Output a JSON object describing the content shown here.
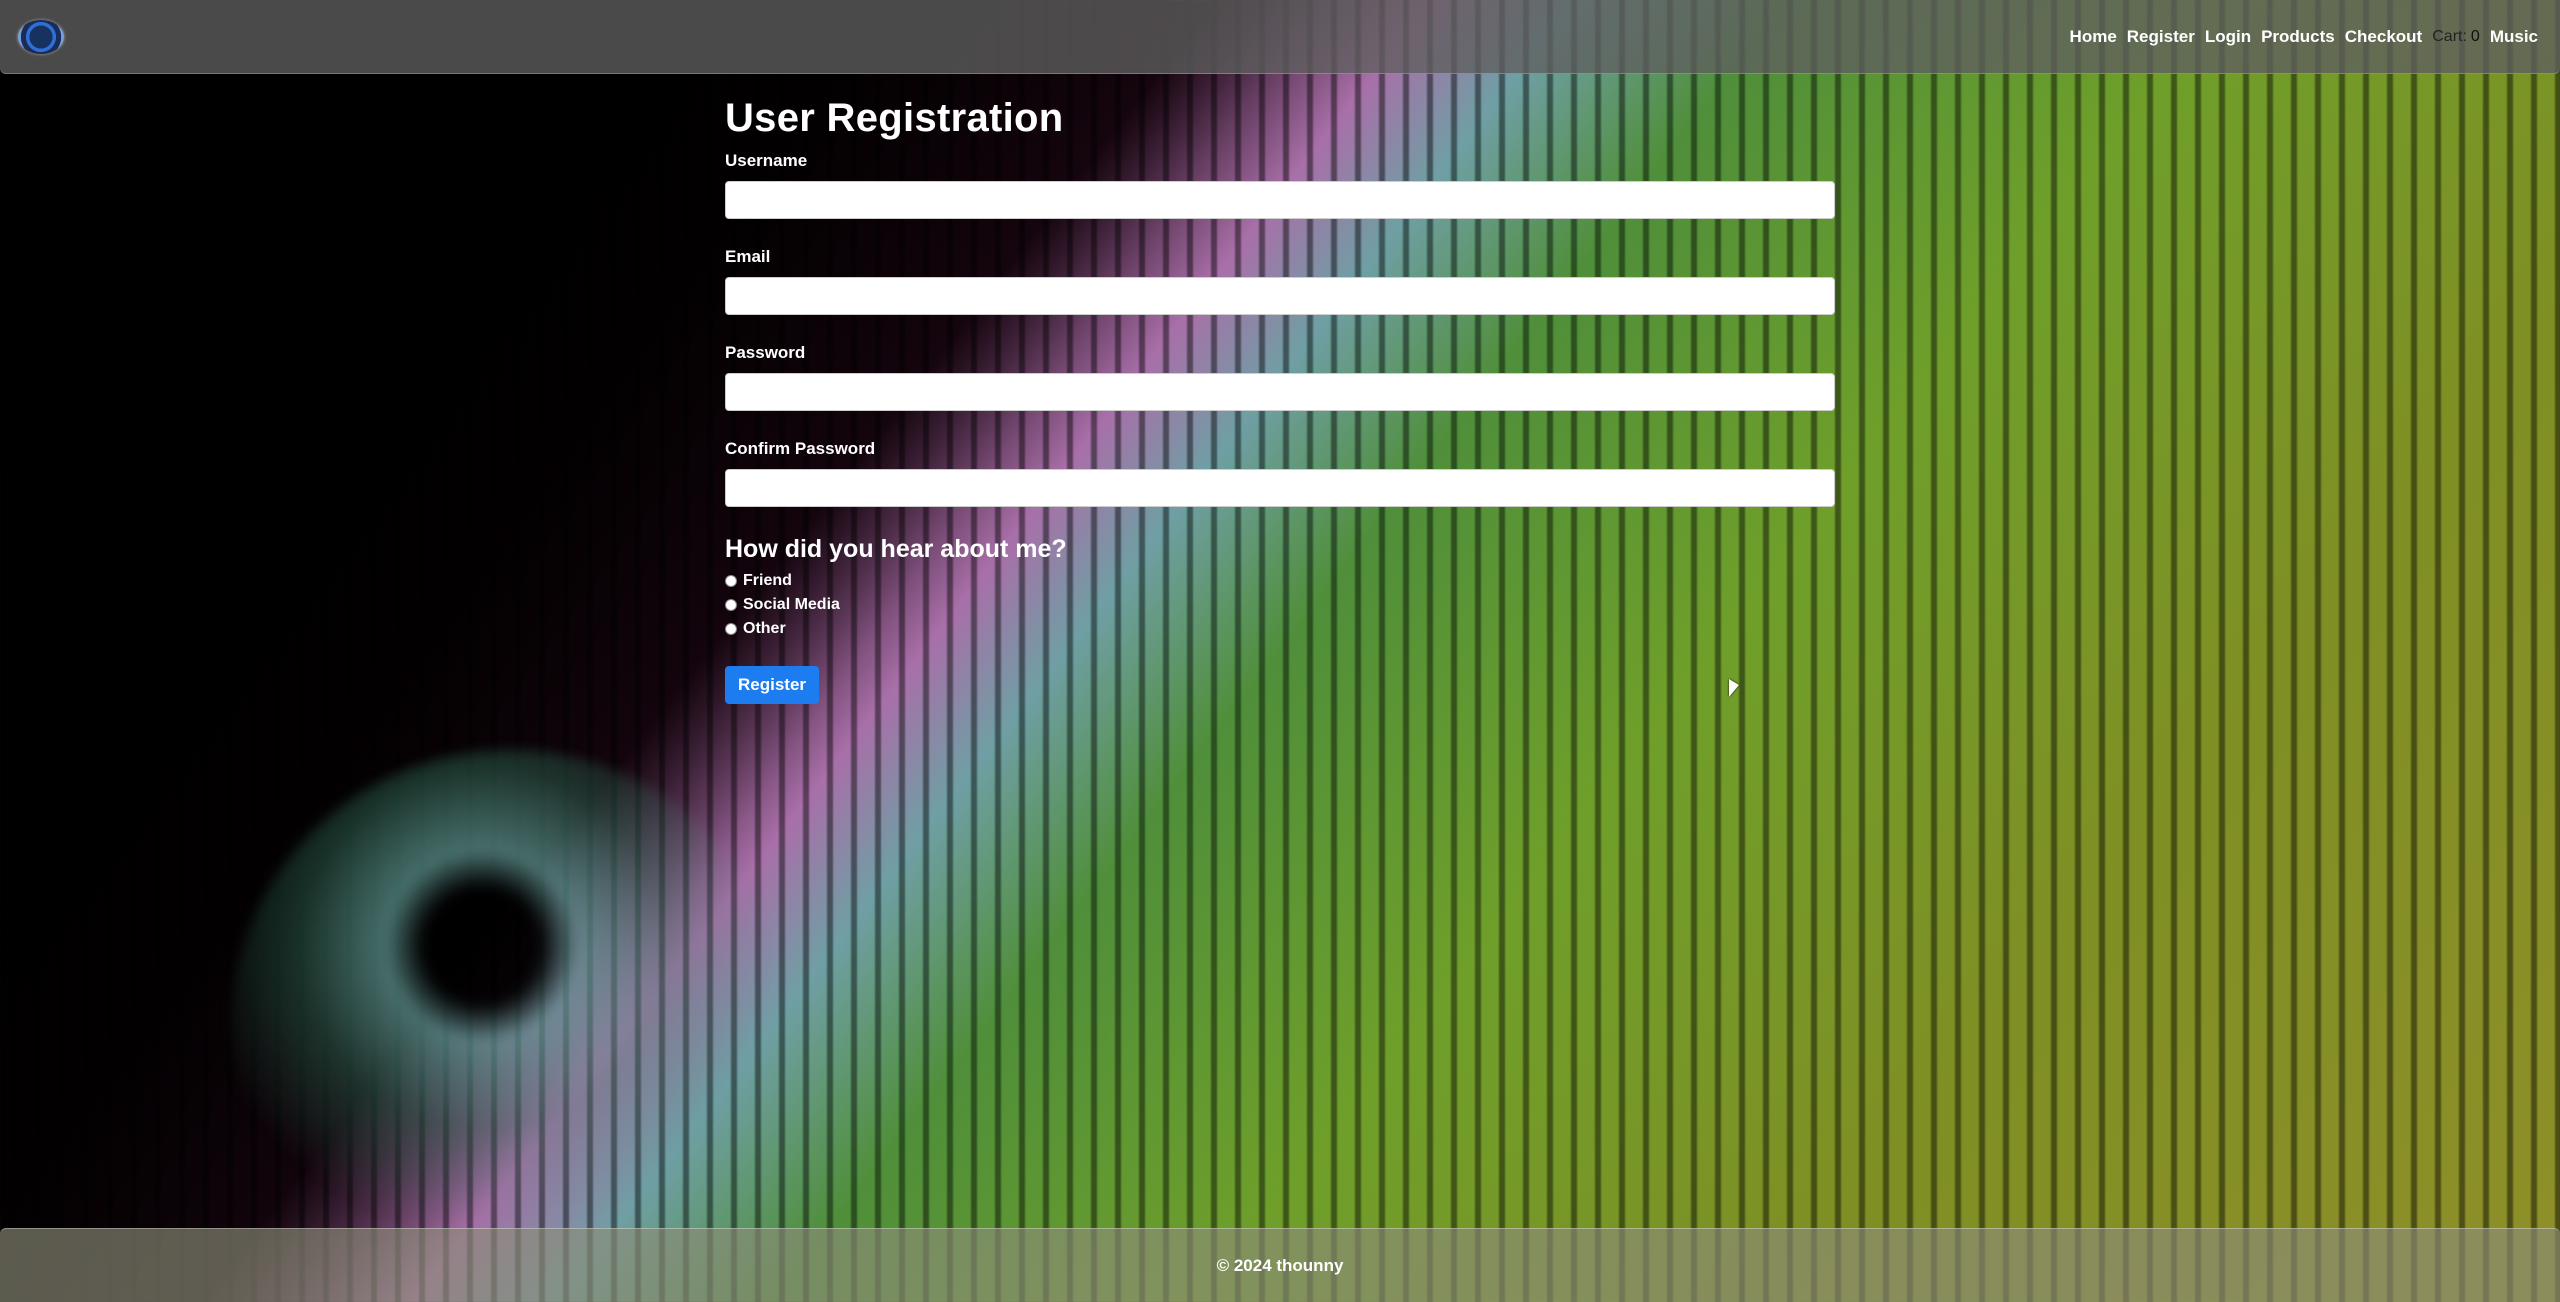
{
  "nav": {
    "logo_icon": "site-logo",
    "links": [
      "Home",
      "Register",
      "Login",
      "Products",
      "Checkout"
    ],
    "cart_label": "Cart:",
    "cart_count": "0",
    "music_label": "Music"
  },
  "form": {
    "title": "User Registration",
    "fields": {
      "username_label": "Username",
      "email_label": "Email",
      "password_label": "Password",
      "confirm_password_label": "Confirm Password"
    },
    "question": "How did you hear about me?",
    "options": [
      "Friend",
      "Social Media",
      "Other"
    ],
    "submit_label": "Register"
  },
  "footer": {
    "text": "© 2024 thounny"
  },
  "colors": {
    "primary_button": "#1c7cf0"
  }
}
